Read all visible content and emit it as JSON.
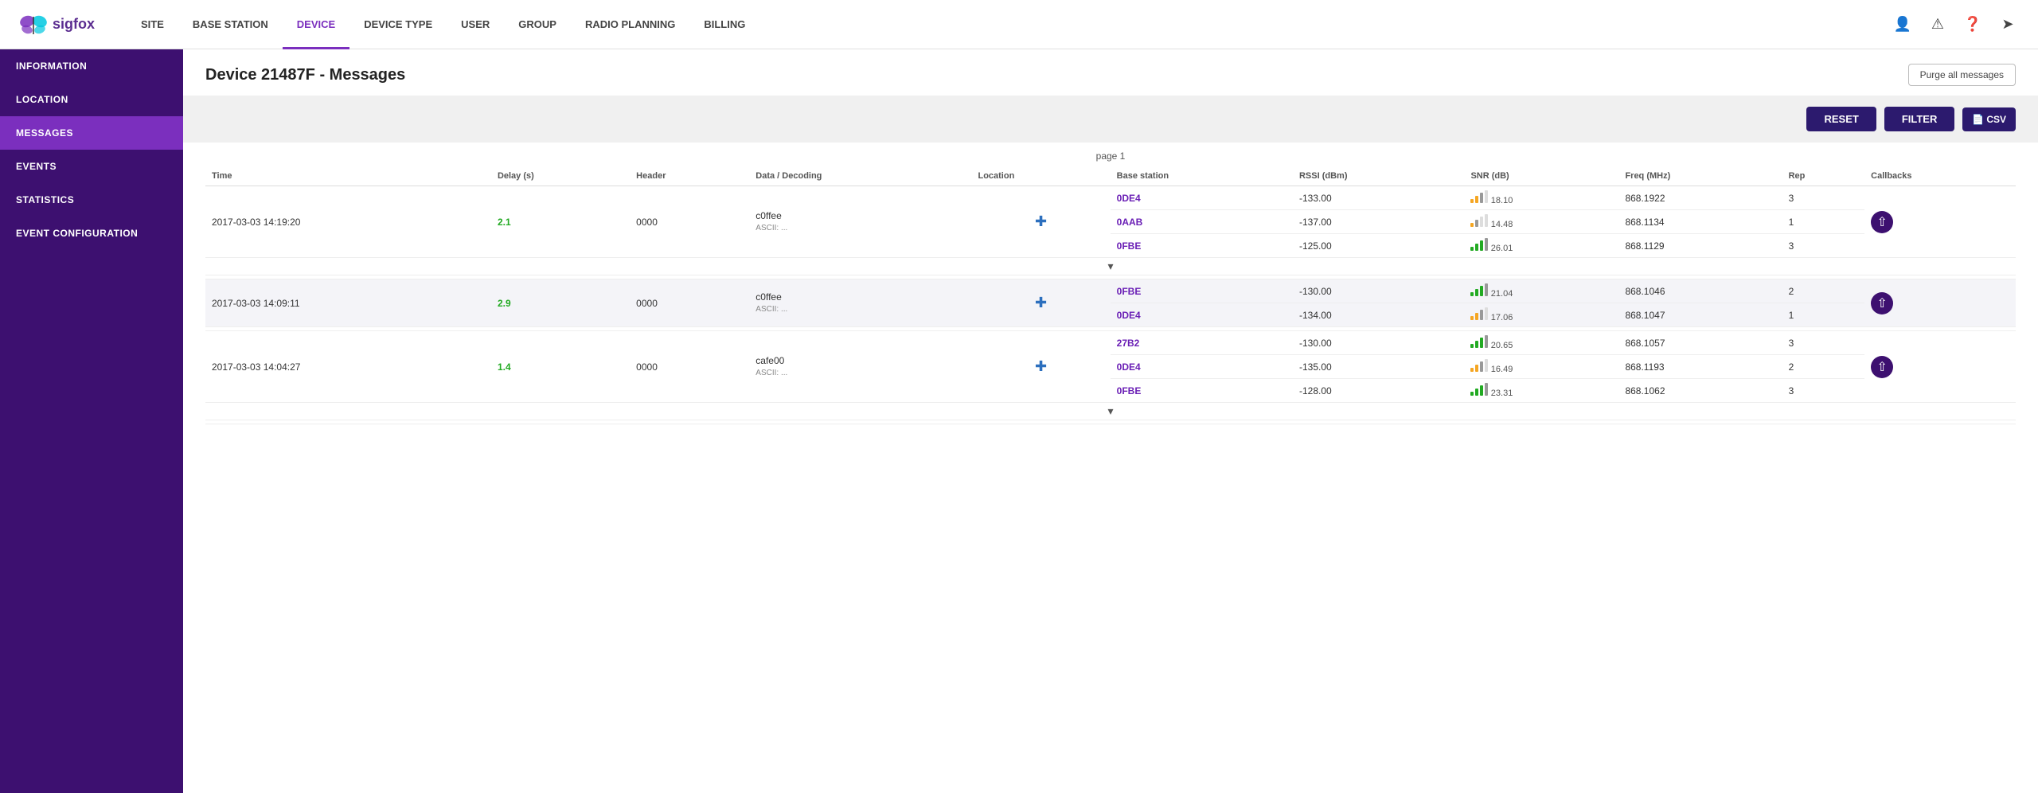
{
  "app": {
    "logo_text": "sigfox"
  },
  "nav": {
    "items": [
      {
        "id": "site",
        "label": "SITE",
        "active": false
      },
      {
        "id": "base-station",
        "label": "BASE STATION",
        "active": false
      },
      {
        "id": "device",
        "label": "DEVICE",
        "active": true
      },
      {
        "id": "device-type",
        "label": "DEVICE TYPE",
        "active": false
      },
      {
        "id": "user",
        "label": "USER",
        "active": false
      },
      {
        "id": "group",
        "label": "GROUP",
        "active": false
      },
      {
        "id": "radio-planning",
        "label": "RADIO PLANNING",
        "active": false
      },
      {
        "id": "billing",
        "label": "BILLING",
        "active": false
      }
    ]
  },
  "sidebar": {
    "items": [
      {
        "id": "information",
        "label": "INFORMATION",
        "active": false
      },
      {
        "id": "location",
        "label": "LOCATION",
        "active": false
      },
      {
        "id": "messages",
        "label": "MESSAGES",
        "active": true
      },
      {
        "id": "events",
        "label": "EVENTS",
        "active": false
      },
      {
        "id": "statistics",
        "label": "STATISTICS",
        "active": false
      },
      {
        "id": "event-configuration",
        "label": "EVENT CONFIGURATION",
        "active": false
      }
    ]
  },
  "page": {
    "title": "Device 21487F - Messages",
    "purge_btn": "Purge all messages",
    "reset_btn": "RESET",
    "filter_btn": "FILTER",
    "csv_btn": "CSV",
    "page_indicator": "page 1"
  },
  "table": {
    "columns": [
      "Time",
      "Delay (s)",
      "Header",
      "Data / Decoding",
      "Location",
      "Base station",
      "RSSI (dBm)",
      "SNR (dB)",
      "Freq (MHz)",
      "Rep",
      "Callbacks"
    ],
    "message_groups": [
      {
        "id": "msg1",
        "time": "2017-03-03 14:19:20",
        "delay": "2.1",
        "header": "0000",
        "data": "c0ffee",
        "ascii": "ASCII: ...",
        "has_location": true,
        "stations": [
          {
            "id": "0DE4",
            "rssi": "-133.00",
            "snr": "18.10",
            "freq": "868.1922",
            "rep": "3",
            "bars": [
              3,
              3,
              2,
              1
            ],
            "bar_colors": [
              "#f5a623",
              "#f5a623",
              "#999",
              "#ddd"
            ]
          },
          {
            "id": "0AAB",
            "rssi": "-137.00",
            "snr": "14.48",
            "freq": "868.1134",
            "rep": "1",
            "bars": [
              3,
              2,
              1,
              1
            ],
            "bar_colors": [
              "#f5a623",
              "#999",
              "#ddd",
              "#ddd"
            ]
          },
          {
            "id": "0FBE",
            "rssi": "-125.00",
            "snr": "26.01",
            "freq": "868.1129",
            "rep": "3",
            "bars": [
              4,
              4,
              3,
              2
            ],
            "bar_colors": [
              "#22aa22",
              "#22aa22",
              "#22aa22",
              "#999"
            ]
          }
        ],
        "has_expand": true,
        "has_upload": true,
        "bg": false
      },
      {
        "id": "msg2",
        "time": "2017-03-03 14:09:11",
        "delay": "2.9",
        "header": "0000",
        "data": "c0ffee",
        "ascii": "ASCII: ...",
        "has_location": true,
        "stations": [
          {
            "id": "0FBE",
            "rssi": "-130.00",
            "snr": "21.04",
            "freq": "868.1046",
            "rep": "2",
            "bars": [
              4,
              4,
              3,
              2
            ],
            "bar_colors": [
              "#22aa22",
              "#22aa22",
              "#22aa22",
              "#999"
            ]
          },
          {
            "id": "0DE4",
            "rssi": "-134.00",
            "snr": "17.06",
            "freq": "868.1047",
            "rep": "1",
            "bars": [
              3,
              3,
              2,
              1
            ],
            "bar_colors": [
              "#f5a623",
              "#f5a623",
              "#999",
              "#ddd"
            ]
          }
        ],
        "has_expand": false,
        "has_upload": true,
        "bg": true
      },
      {
        "id": "msg3",
        "time": "2017-03-03 14:04:27",
        "delay": "1.4",
        "header": "0000",
        "data": "cafe00",
        "ascii": "ASCII: ...",
        "has_location": true,
        "stations": [
          {
            "id": "27B2",
            "rssi": "-130.00",
            "snr": "20.65",
            "freq": "868.1057",
            "rep": "3",
            "bars": [
              4,
              4,
              3,
              2
            ],
            "bar_colors": [
              "#22aa22",
              "#22aa22",
              "#22aa22",
              "#999"
            ]
          },
          {
            "id": "0DE4",
            "rssi": "-135.00",
            "snr": "16.49",
            "freq": "868.1193",
            "rep": "2",
            "bars": [
              3,
              3,
              2,
              1
            ],
            "bar_colors": [
              "#f5a623",
              "#f5a623",
              "#999",
              "#ddd"
            ]
          },
          {
            "id": "0FBE",
            "rssi": "-128.00",
            "snr": "23.31",
            "freq": "868.1062",
            "rep": "3",
            "bars": [
              4,
              4,
              3,
              2
            ],
            "bar_colors": [
              "#22aa22",
              "#22aa22",
              "#22aa22",
              "#999"
            ]
          }
        ],
        "has_expand": true,
        "has_upload": true,
        "bg": false
      }
    ]
  }
}
